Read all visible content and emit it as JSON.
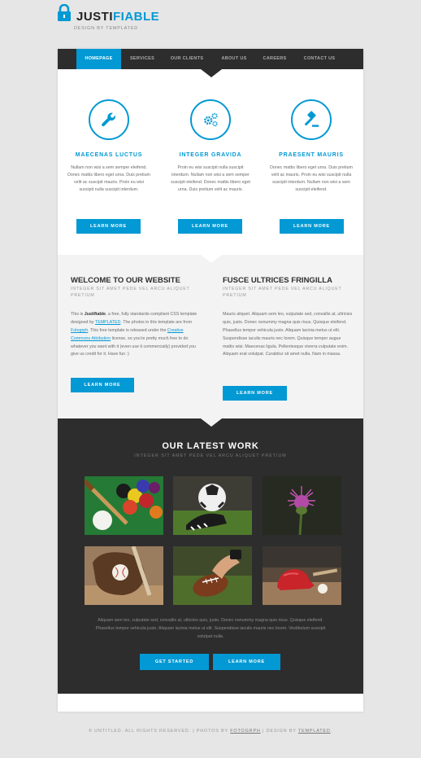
{
  "logo": {
    "text_dark": "JUSTI",
    "text_accent": "FIABLE",
    "tagline": "DESIGN BY TEMPLATED"
  },
  "nav": {
    "items": [
      "HOMEPAGE",
      "SERVICES",
      "OUR CLIENTS",
      "ABOUT US",
      "CAREERS",
      "CONTACT US"
    ]
  },
  "features": [
    {
      "icon": "wrench-icon",
      "title": "MAECENAS LUCTUS",
      "text": "Nullam non wisi a sem semper eleifend. Donec mattis libero eget urna. Duis pretium velit ac suscipit mauris. Proin eu wisi suscipit nulla suscipit interdum.",
      "button": "LEARN MORE"
    },
    {
      "icon": "gears-icon",
      "title": "INTEGER GRAVIDA",
      "text": "Proin eu wisi suscipit nulla suscipit interdum. Nullam non wisi a sem semper suscipit eleifend. Donec mattis libero eget urna. Duis pretium velit ac mauris.",
      "button": "LEARN MORE"
    },
    {
      "icon": "gavel-icon",
      "title": "PRAESENT MAURIS",
      "text": "Donec mattis libero eget urna. Duis pretium velit ac mauris. Proin eu wisi suscipit nulla suscipit interdum. Nullam non wisi a sem suscipit eleifend.",
      "button": "LEARN MORE"
    }
  ],
  "welcome": {
    "title": "WELCOME TO OUR WEBSITE",
    "subtitle": "INTEGER SIT AMET PEDE VEL ARCU ALIQUET PRETIUM",
    "p1": "This is ",
    "brand": "Justifiable",
    "p2": ", a free, fully standards-compliant CSS template designed by ",
    "link1": "TEMPLATED",
    "p3": ". The photos in this template are from ",
    "link2": "Fotogrph",
    "p4": ". This free template is released under the ",
    "link3": "Creative Commons Attribution",
    "p5": " license, so you're pretty much free to do whatever you want with it (even use it commercially) provided you give us credit for it. Have fun :)",
    "button": "LEARN MORE"
  },
  "fusce": {
    "title": "FUSCE ULTRICES FRINGILLA",
    "subtitle": "INTEGER SIT AMET PEDE VEL ARCU ALIQUET PRETIUM",
    "text": "Mauris aliquet. Aliquam sem leo, vulputate sed, convallis at, ultricies quis, justo. Donec nonummy magna quis risus. Quisque eleifend. Phasellus tempor vehicula justo. Aliquam lacinia metus ut elit. Suspendisse iaculis mauris nec lorem. Quisque tempor augue mattis wisi. Maecenas ligula. Pellentesque viverra vulputate enim. Aliquam erat volutpat. Curabitur sit amet nulla. Nam in massa.",
    "button": "LEARN MORE"
  },
  "work": {
    "title": "OUR LATEST WORK",
    "subtitle": "INTEGER SIT AMET PEDE VEL ARCU ALIQUET PRETIUM",
    "images": [
      "billiards-image",
      "soccer-image",
      "thistle-image",
      "baseball-glove-image",
      "football-image",
      "baseball-helmet-image"
    ],
    "text": "Aliquam sem leo, vulputate sed, convallis at, ultricies quis, justo. Donec nonummy magna quis risus. Quisque eleifend. Phasellus tempor vehicula justo. Aliquam lacinia metus ut elit. Suspendisse iaculis mauris nec lorem. Vestibulum suscipit volutpat nulla.",
    "button1": "GET STARTED",
    "button2": "LEARN MORE"
  },
  "footer": {
    "copy": "© UNTITLED. ALL RIGHTS RESERVED. | PHOTOS BY ",
    "link1": "FOTOGRPH",
    "mid": " | DESIGN BY ",
    "link2": "TEMPLATED",
    "end": "."
  },
  "colors": {
    "accent": "#0299d4",
    "dark": "#2d2d2d",
    "light": "#f3f3f3"
  }
}
